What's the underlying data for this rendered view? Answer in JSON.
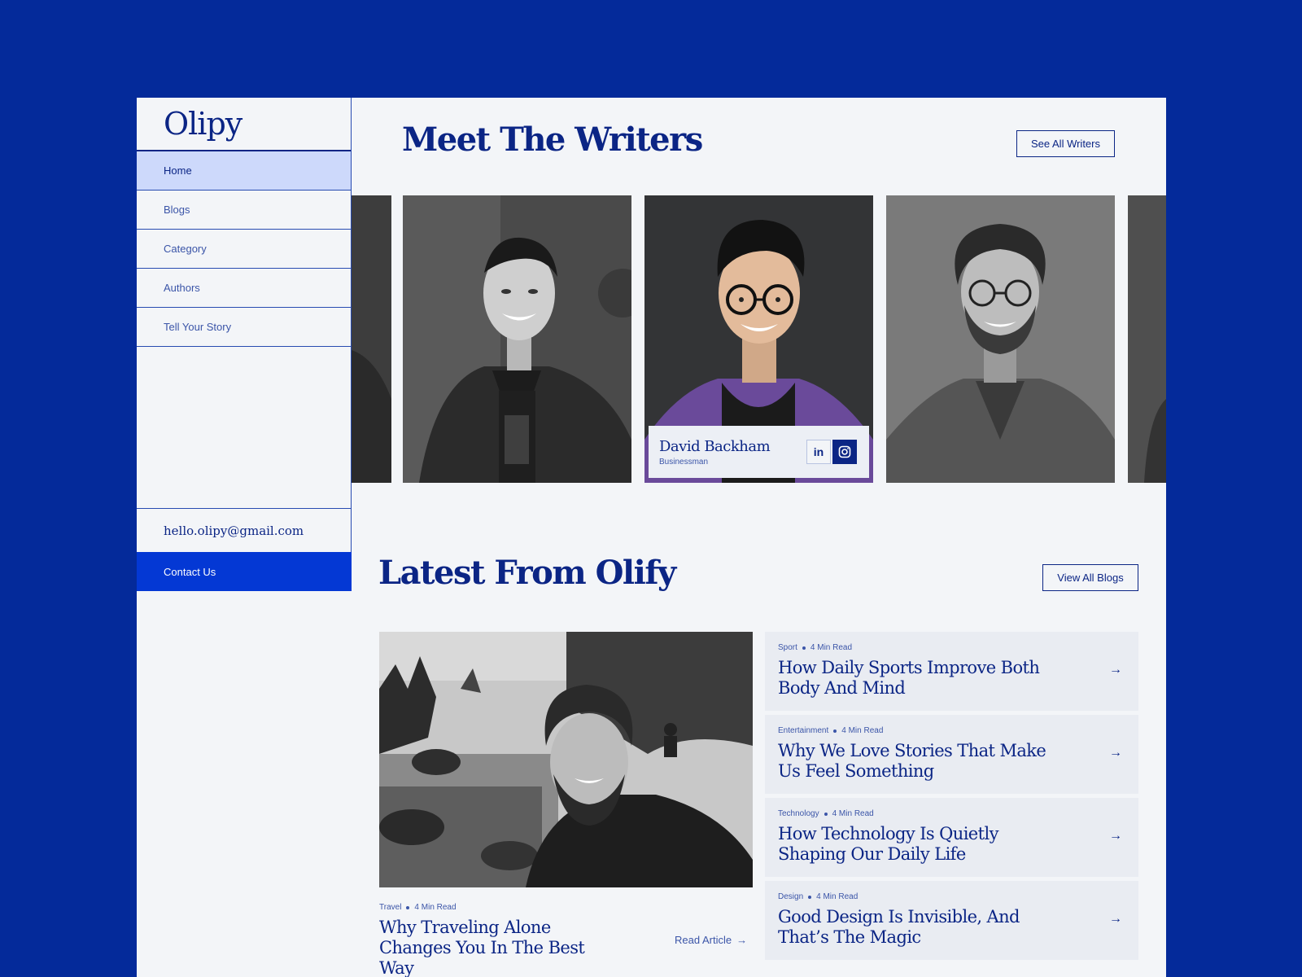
{
  "brand": {
    "logo": "Olipy"
  },
  "sidebar": {
    "items": [
      {
        "label": "Home",
        "active": true
      },
      {
        "label": "Blogs",
        "active": false
      },
      {
        "label": "Category",
        "active": false
      },
      {
        "label": "Authors",
        "active": false
      },
      {
        "label": "Tell Your Story",
        "active": false
      }
    ],
    "email": "hello.olipy@gmail.com",
    "contact_label": "Contact Us"
  },
  "writers": {
    "title": "Meet The Writers",
    "see_all_label": "See All Writers",
    "featured": {
      "name": "David Backham",
      "role": "Businessman",
      "social": [
        "linkedin-icon",
        "instagram-icon"
      ]
    }
  },
  "latest": {
    "title": "Latest From Olify",
    "view_all_label": "View All Blogs",
    "featured": {
      "category": "Travel",
      "read_time": "4 Min Read",
      "title": "Why Traveling Alone Changes You In The Best Way",
      "cta": "Read Article"
    },
    "posts": [
      {
        "category": "Sport",
        "read_time": "4 Min Read",
        "title": "How Daily Sports Improve Both Body And Mind"
      },
      {
        "category": "Entertainment",
        "read_time": "4 Min Read",
        "title": "Why We Love Stories That Make Us Feel Something"
      },
      {
        "category": "Technology",
        "read_time": "4 Min Read",
        "title": "How Technology Is Quietly Shaping Our Daily Life"
      },
      {
        "category": "Design",
        "read_time": "4 Min Read",
        "title": "Good Design Is Invisible, And That’s The Magic"
      }
    ]
  },
  "colors": {
    "background": "#042a9a",
    "primary": "#0b2585",
    "accent": "#0438d4",
    "active_nav": "#cdd9fb",
    "page": "#f3f5f8"
  }
}
